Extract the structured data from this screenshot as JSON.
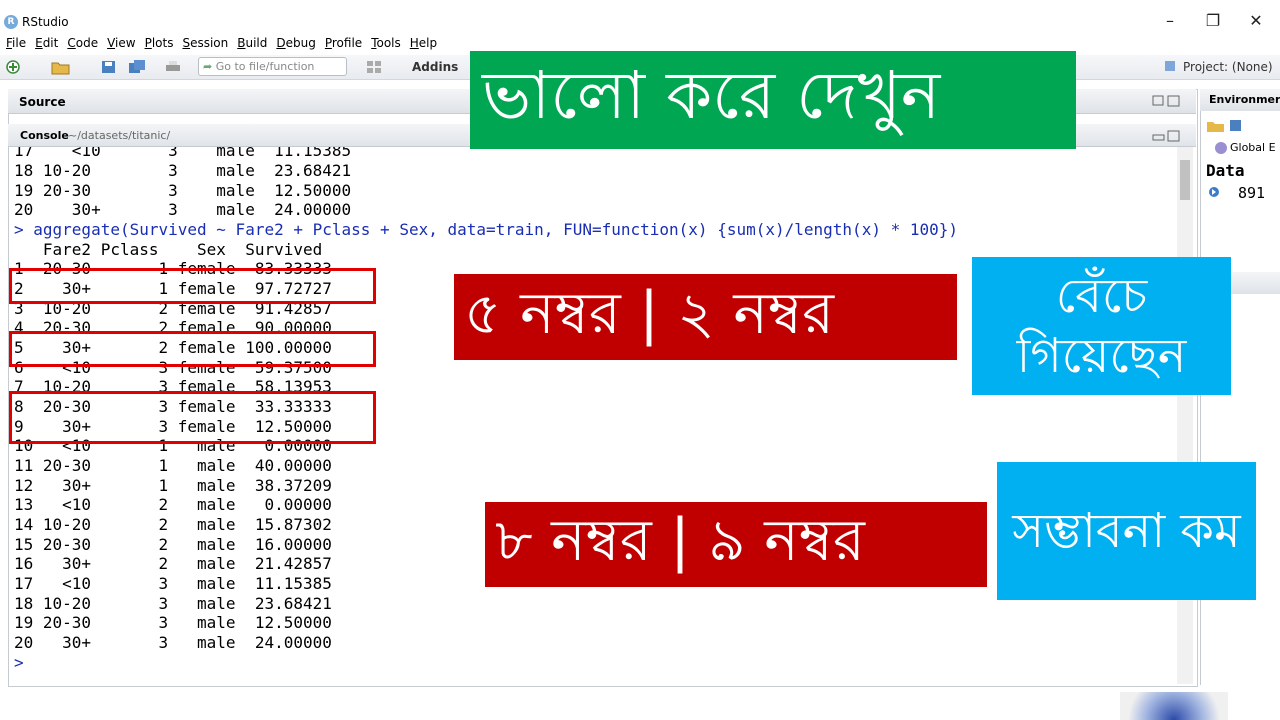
{
  "window": {
    "title": "RStudio",
    "app_icon": "R",
    "minimize": "–",
    "maximize": "❐",
    "close": "✕"
  },
  "menubar": [
    "File",
    "Edit",
    "Code",
    "View",
    "Plots",
    "Session",
    "Build",
    "Debug",
    "Profile",
    "Tools",
    "Help"
  ],
  "toolbar": {
    "goto_placeholder": "Go to file/function",
    "addins_label": "Addins",
    "project_label": "Project: (None)"
  },
  "source_pane": {
    "tab": "Source"
  },
  "console_pane": {
    "tab": "Console",
    "path": "~/datasets/titanic/",
    "lines": [
      "17    <10       3    male  11.15385",
      "18 10-20        3    male  23.68421",
      "19 20-30        3    male  12.50000",
      "20    30+       3    male  24.00000",
      "> aggregate(Survived ~ Fare2 + Pclass + Sex, data=train, FUN=function(x) {sum(x)/length(x) * 100})",
      "   Fare2 Pclass    Sex  Survived",
      "1  20-30       1 female  83.33333",
      "2    30+       1 female  97.72727",
      "3  10-20       2 female  91.42857",
      "4  20-30       2 female  90.00000",
      "5    30+       2 female 100.00000",
      "6    <10       3 female  59.37500",
      "7  10-20       3 female  58.13953",
      "8  20-30       3 female  33.33333",
      "9    30+       3 female  12.50000",
      "10   <10       1   male   0.00000",
      "11 20-30       1   male  40.00000",
      "12   30+       1   male  38.37209",
      "13   <10       2   male   0.00000",
      "14 10-20       2   male  15.87302",
      "15 20-30       2   male  16.00000",
      "16   30+       2   male  21.42857",
      "17   <10       3   male  11.15385",
      "18 10-20       3   male  23.68421",
      "19 20-30       3   male  12.50000",
      "20   30+       3   male  24.00000",
      ">"
    ]
  },
  "environment_pane": {
    "tab": "Environmer",
    "scope": "Global E",
    "section": "Data",
    "value": "891"
  },
  "overlays": {
    "green": "ভালো করে দেখুন",
    "red_1": "৫ নম্বর | ২ নম্বর",
    "blue_1": "বেঁচে গিয়েছেন",
    "red_2": "৮ নম্বর | ৯ নম্বর",
    "blue_2": "সম্ভাবনা কম"
  },
  "colors": {
    "green": "#00a651",
    "red": "#c00000",
    "blue": "#00b0f0",
    "box_border": "#e00000"
  }
}
